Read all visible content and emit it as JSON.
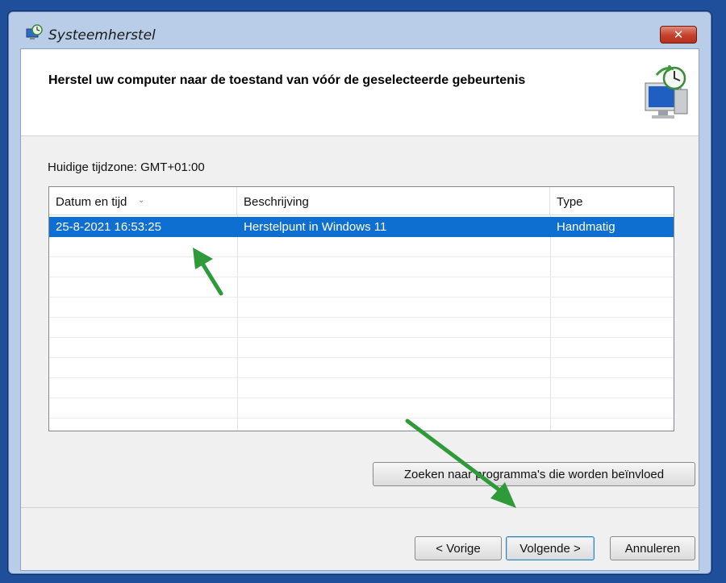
{
  "window": {
    "title": "Systeemherstel",
    "close_glyph": "✕"
  },
  "header": {
    "title": "Herstel uw computer naar de toestand van vóór de geselecteerde gebeurtenis"
  },
  "timezone_label": "Huidige tijdzone: GMT+01:00",
  "table": {
    "columns": [
      "Datum en tijd",
      "Beschrijving",
      "Type"
    ],
    "sort_indicator": "⌄",
    "rows": [
      {
        "datetime": "25-8-2021 16:53:25",
        "description": "Herstelpunt in Windows 11",
        "type": "Handmatig",
        "selected": true
      }
    ]
  },
  "buttons": {
    "scan": "Zoeken naar programma's die worden beïnvloed",
    "back": "< Vorige",
    "next": "Volgende >",
    "cancel": "Annuleren"
  },
  "colors": {
    "selection": "#0e6fd1",
    "annotation_arrow": "#2f9a3a",
    "desktop": "#1f4f9a"
  },
  "icons": [
    "system-restore-icon",
    "close-icon",
    "restore-computer-icon",
    "sort-arrow-icon"
  ]
}
